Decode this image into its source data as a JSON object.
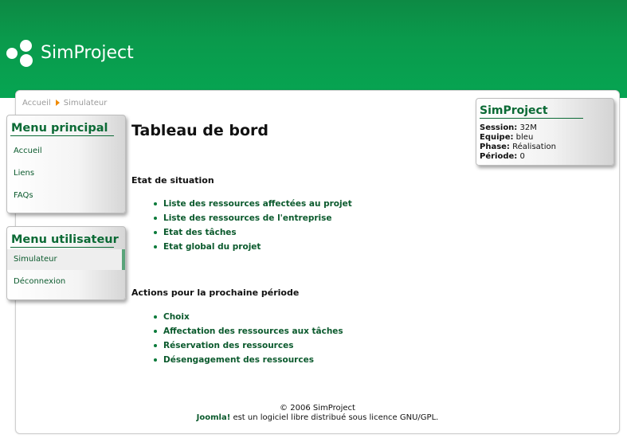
{
  "header": {
    "site_name": "SimProject"
  },
  "breadcrumb": {
    "items": [
      "Accueil",
      "Simulateur"
    ]
  },
  "menu_principal": {
    "title": "Menu principal",
    "items": [
      "Accueil",
      "Liens",
      "FAQs"
    ]
  },
  "menu_utilisateur": {
    "title": "Menu utilisateur",
    "items": [
      "Simulateur",
      "Déconnexion"
    ],
    "active_item": "Simulateur"
  },
  "main": {
    "title": "Tableau de bord",
    "sections": [
      {
        "title": "Etat de situation",
        "links": [
          "Liste des ressources affectées au projet",
          "Liste des ressources de l'entreprise",
          "Etat des tâches",
          "Etat global du projet"
        ]
      },
      {
        "title": "Actions pour la prochaine période",
        "links": [
          "Choix",
          "Affectation des ressources aux tâches",
          "Réservation des ressources",
          "Désengagement des ressources"
        ]
      }
    ]
  },
  "info_box": {
    "title": "SimProject",
    "rows": [
      {
        "label": "Session:",
        "value": "32M"
      },
      {
        "label": "Equipe:",
        "value": "bleu"
      },
      {
        "label": "Phase:",
        "value": "Réalisation"
      },
      {
        "label": "Période:",
        "value": "0"
      }
    ]
  },
  "footer": {
    "copyright": "© 2006 SimProject",
    "joomla_link": "Joomla!",
    "license_text": " est un logiciel libre distribué sous licence GNU/GPL."
  },
  "colors": {
    "header_green": "#0a9a4c",
    "link_green": "#0b5a2d",
    "title_green": "#0b6a35",
    "breadcrumb_arrow": "#f08a00"
  }
}
